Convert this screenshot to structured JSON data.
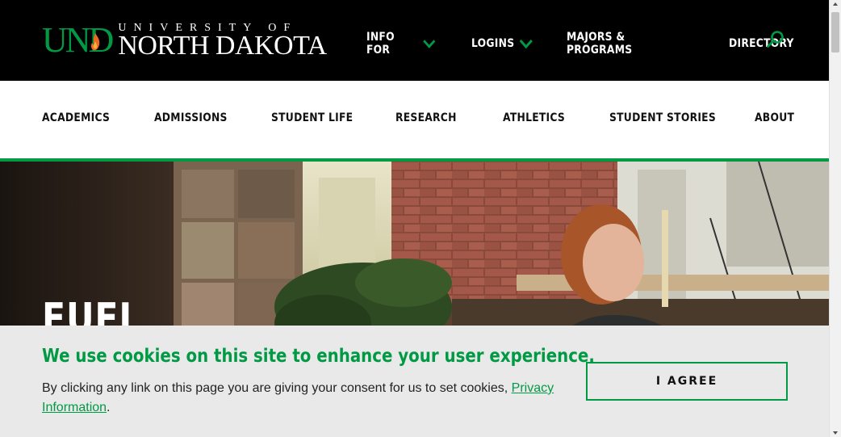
{
  "brand": {
    "logo_mark": "UND",
    "university_of": "UNIVERSITY OF",
    "name": "NORTH DAKOTA",
    "green": "#009a44",
    "black": "#000000"
  },
  "topnav": {
    "info_for": "INFO FOR",
    "logins": "LOGINS",
    "majors": "MAJORS & PROGRAMS",
    "directory": "DIRECTORY",
    "search_icon": "search-icon"
  },
  "mainnav": {
    "items": [
      "ACADEMICS",
      "ADMISSIONS",
      "STUDENT LIFE",
      "RESEARCH",
      "ATHLETICS",
      "STUDENT STORIES",
      "ABOUT"
    ]
  },
  "hero": {
    "title": "FUEL"
  },
  "cookie": {
    "title": "We use cookies on this site to enhance your user experience.",
    "text": "By clicking any link on this page you are giving your consent for us to set cookies,",
    "link": "Privacy Information",
    "period": ".",
    "agree": "I AGREE"
  }
}
